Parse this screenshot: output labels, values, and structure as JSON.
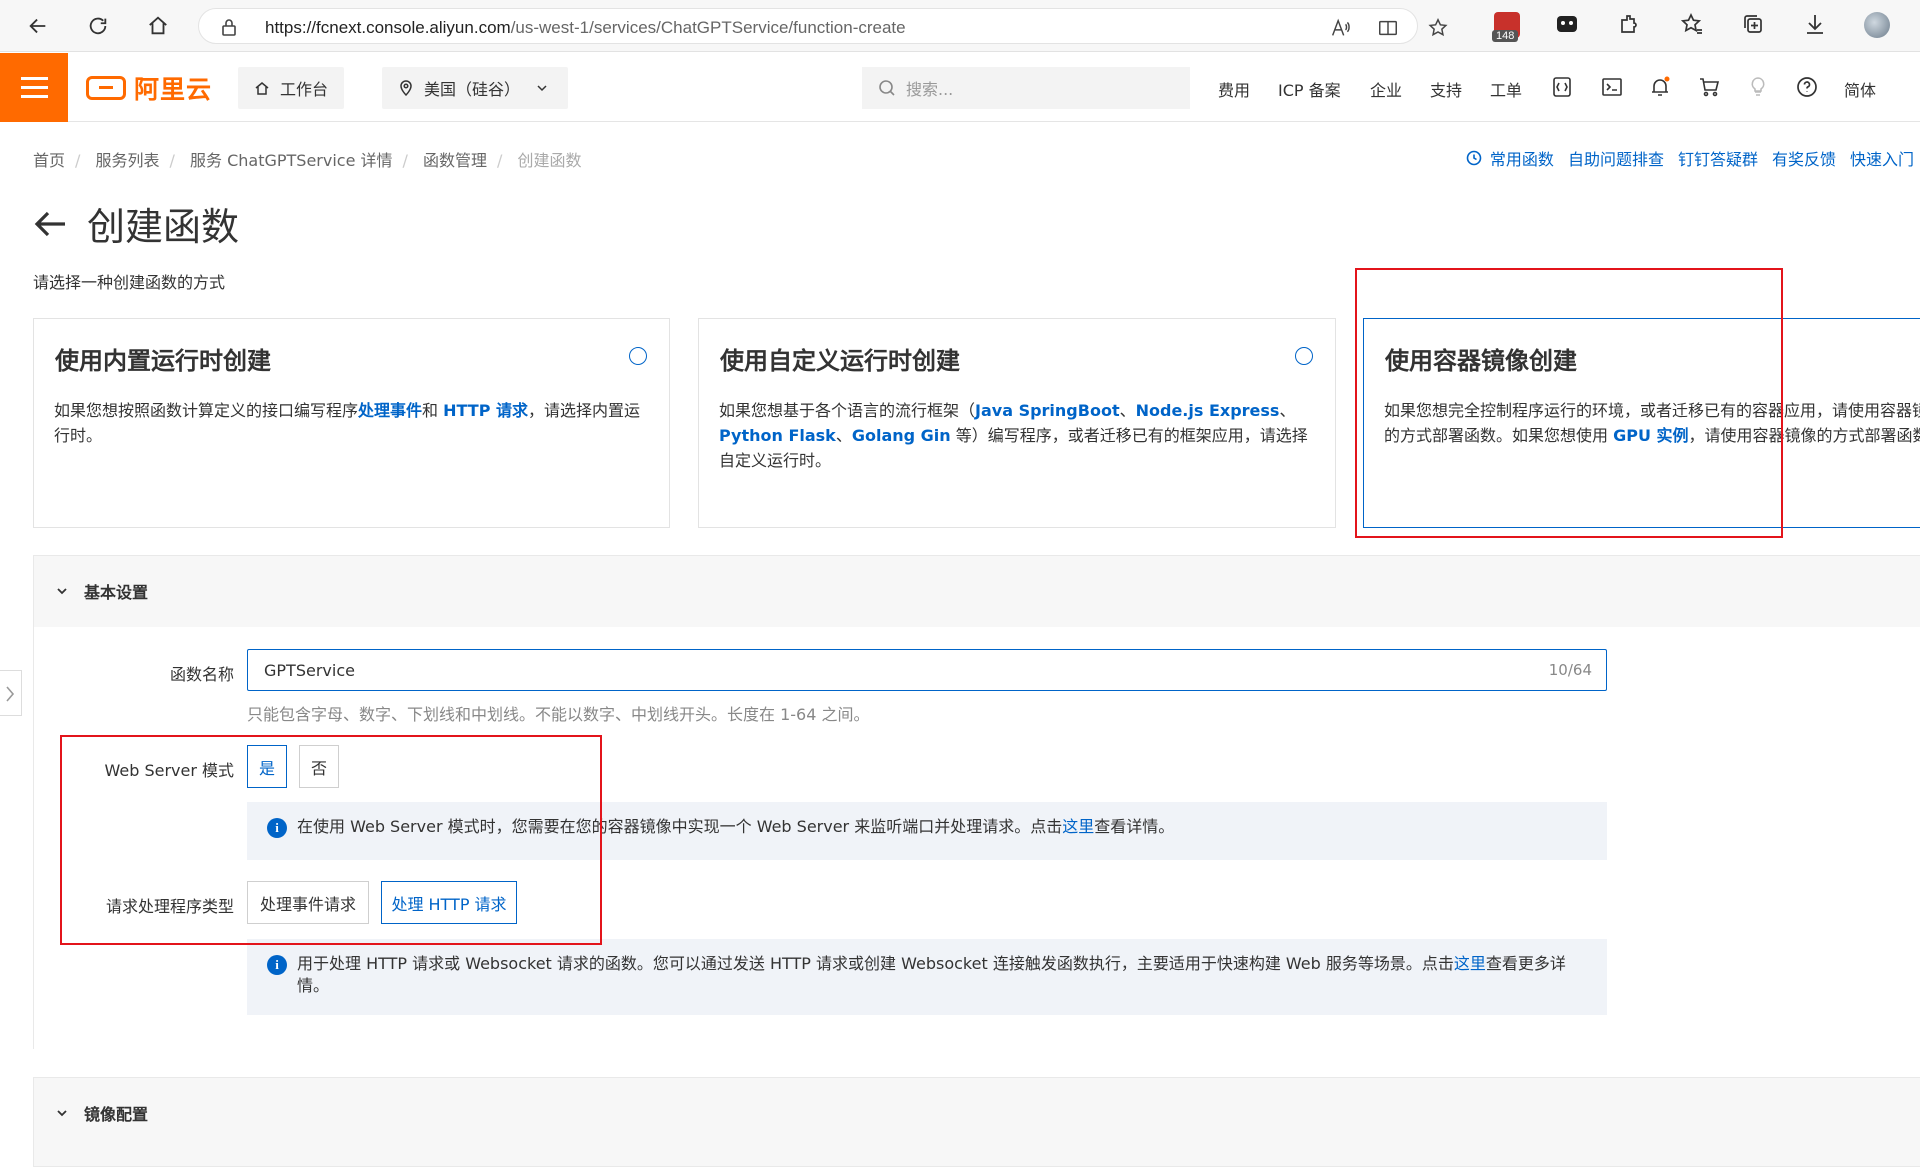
{
  "browser": {
    "url_main": "https://fcnext.console.aliyun.com",
    "url_path": "/us-west-1/services/ChatGPTService/function-create",
    "badge_count": "148"
  },
  "header": {
    "brand": "阿里云",
    "workbench": "工作台",
    "region": "美国（硅谷）",
    "search_placeholder": "搜索...",
    "links": [
      "费用",
      "ICP 备案",
      "企业",
      "支持",
      "工单"
    ],
    "lang": "简体"
  },
  "breadcrumb": {
    "items": [
      "首页",
      "服务列表",
      "服务 ChatGPTService 详情",
      "函数管理"
    ],
    "current": "创建函数"
  },
  "quick_links": [
    "常用函数",
    "自助问题排查",
    "钉钉答疑群",
    "有奖反馈",
    "快速入门"
  ],
  "page": {
    "title": "创建函数",
    "subtitle": "请选择一种创建函数的方式"
  },
  "cards": [
    {
      "title": "使用内置运行时创建",
      "desc_parts": [
        "如果您想按照函数计算定义的接口编写程序",
        "处理事件",
        "和 ",
        "HTTP 请求",
        "，请选择内置运行时。"
      ]
    },
    {
      "title": "使用自定义运行时创建",
      "desc_parts": [
        "如果您想基于各个语言的流行框架（",
        "Java SpringBoot",
        "、",
        "Node.js Express",
        "、",
        "Python Flask",
        "、",
        "Golang Gin",
        " 等）编写程序，或者迁移已有的框架应用，请选择自定义运行时。"
      ]
    },
    {
      "title": "使用容器镜像创建",
      "desc_parts": [
        "如果您想完全控制程序运行的环境，或者迁移已有的容器应用，请使用容器镜像的方式部署函数。如果您想使用 ",
        "GPU 实例",
        "，请使用容器镜像的方式部署函数"
      ]
    }
  ],
  "basic": {
    "title": "基本设置",
    "name_label": "函数名称",
    "name_value": "GPTService",
    "name_count": "10/64",
    "name_help": "只能包含字母、数字、下划线和中划线。不能以数字、中划线开头。长度在 1-64 之间。",
    "ws_label": "Web Server 模式",
    "ws_yes": "是",
    "ws_no": "否",
    "ws_notice": "在使用 Web Server 模式时，您需要在您的容器镜像中实现一个 Web Server 来监听端口并处理请求。点击",
    "ws_notice_link": "这里",
    "ws_notice_end": "查看详情。",
    "handler_label": "请求处理程序类型",
    "handler_event": "处理事件请求",
    "handler_http": "处理 HTTP 请求",
    "handler_notice": "用于处理 HTTP 请求或 Websocket 请求的函数。您可以通过发送 HTTP 请求或创建 Websocket 连接触发函数执行，主要适用于快速构建 Web 服务等场景。点击",
    "handler_notice_link": "这里",
    "handler_notice_end": "查看更多详情。"
  },
  "image_section": {
    "title": "镜像配置"
  }
}
